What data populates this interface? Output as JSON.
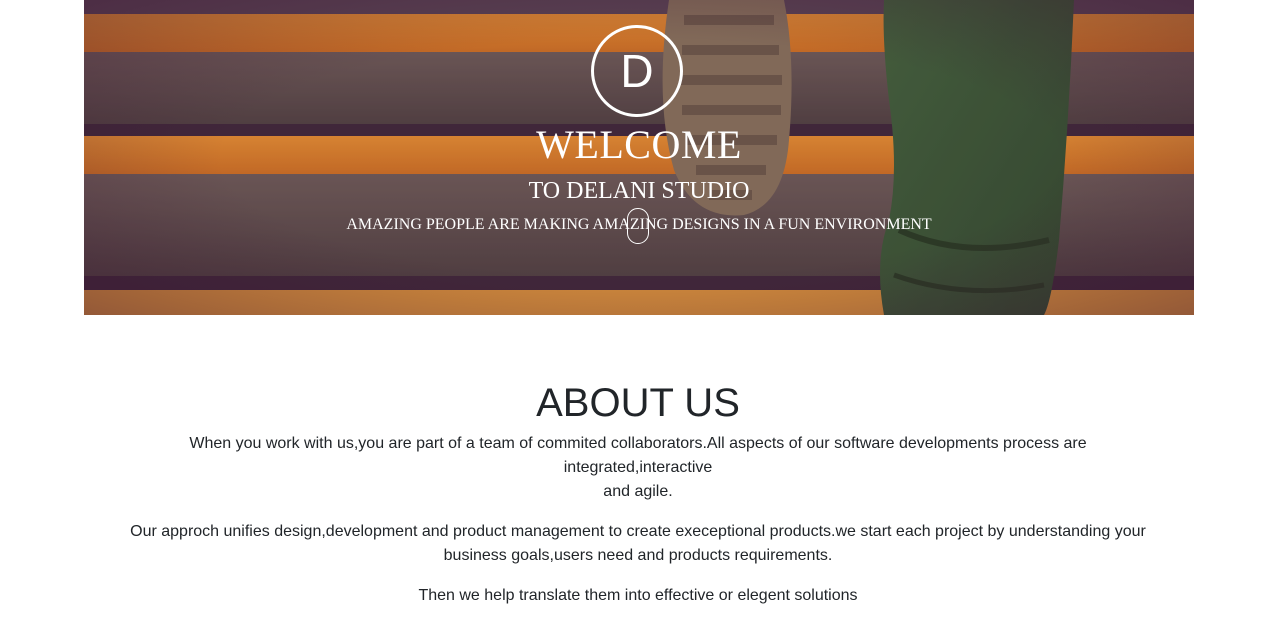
{
  "hero": {
    "logo_letter": "D",
    "title": "WELCOME",
    "subtitle": "TO DELANI STUDIO",
    "tagline": "AMAZING PEOPLE ARE MAKING AMAZING DESIGNS IN A FUN ENVIRONMENT",
    "background_image": "stairs-with-sneaker-photo",
    "scroll_icon": "mouse-scroll-icon"
  },
  "about": {
    "heading": "ABOUT US",
    "paragraph1_line1": "When you work with us,you are part of a team of commited collaborators.All aspects of our software developments process are integrated,interactive",
    "paragraph1_line2": "and agile.",
    "paragraph2": "Our approch unifies design,development and product management to create execeptional products.we start each project by understanding your business goals,users need and products requirements.",
    "paragraph3": "Then we help translate them into effective or elegent solutions"
  },
  "colors": {
    "text_dark": "#212529",
    "stripe_orange": "#e8902a",
    "step_gray": "#5a5048",
    "overlay_purple": "#4a1e3c"
  }
}
